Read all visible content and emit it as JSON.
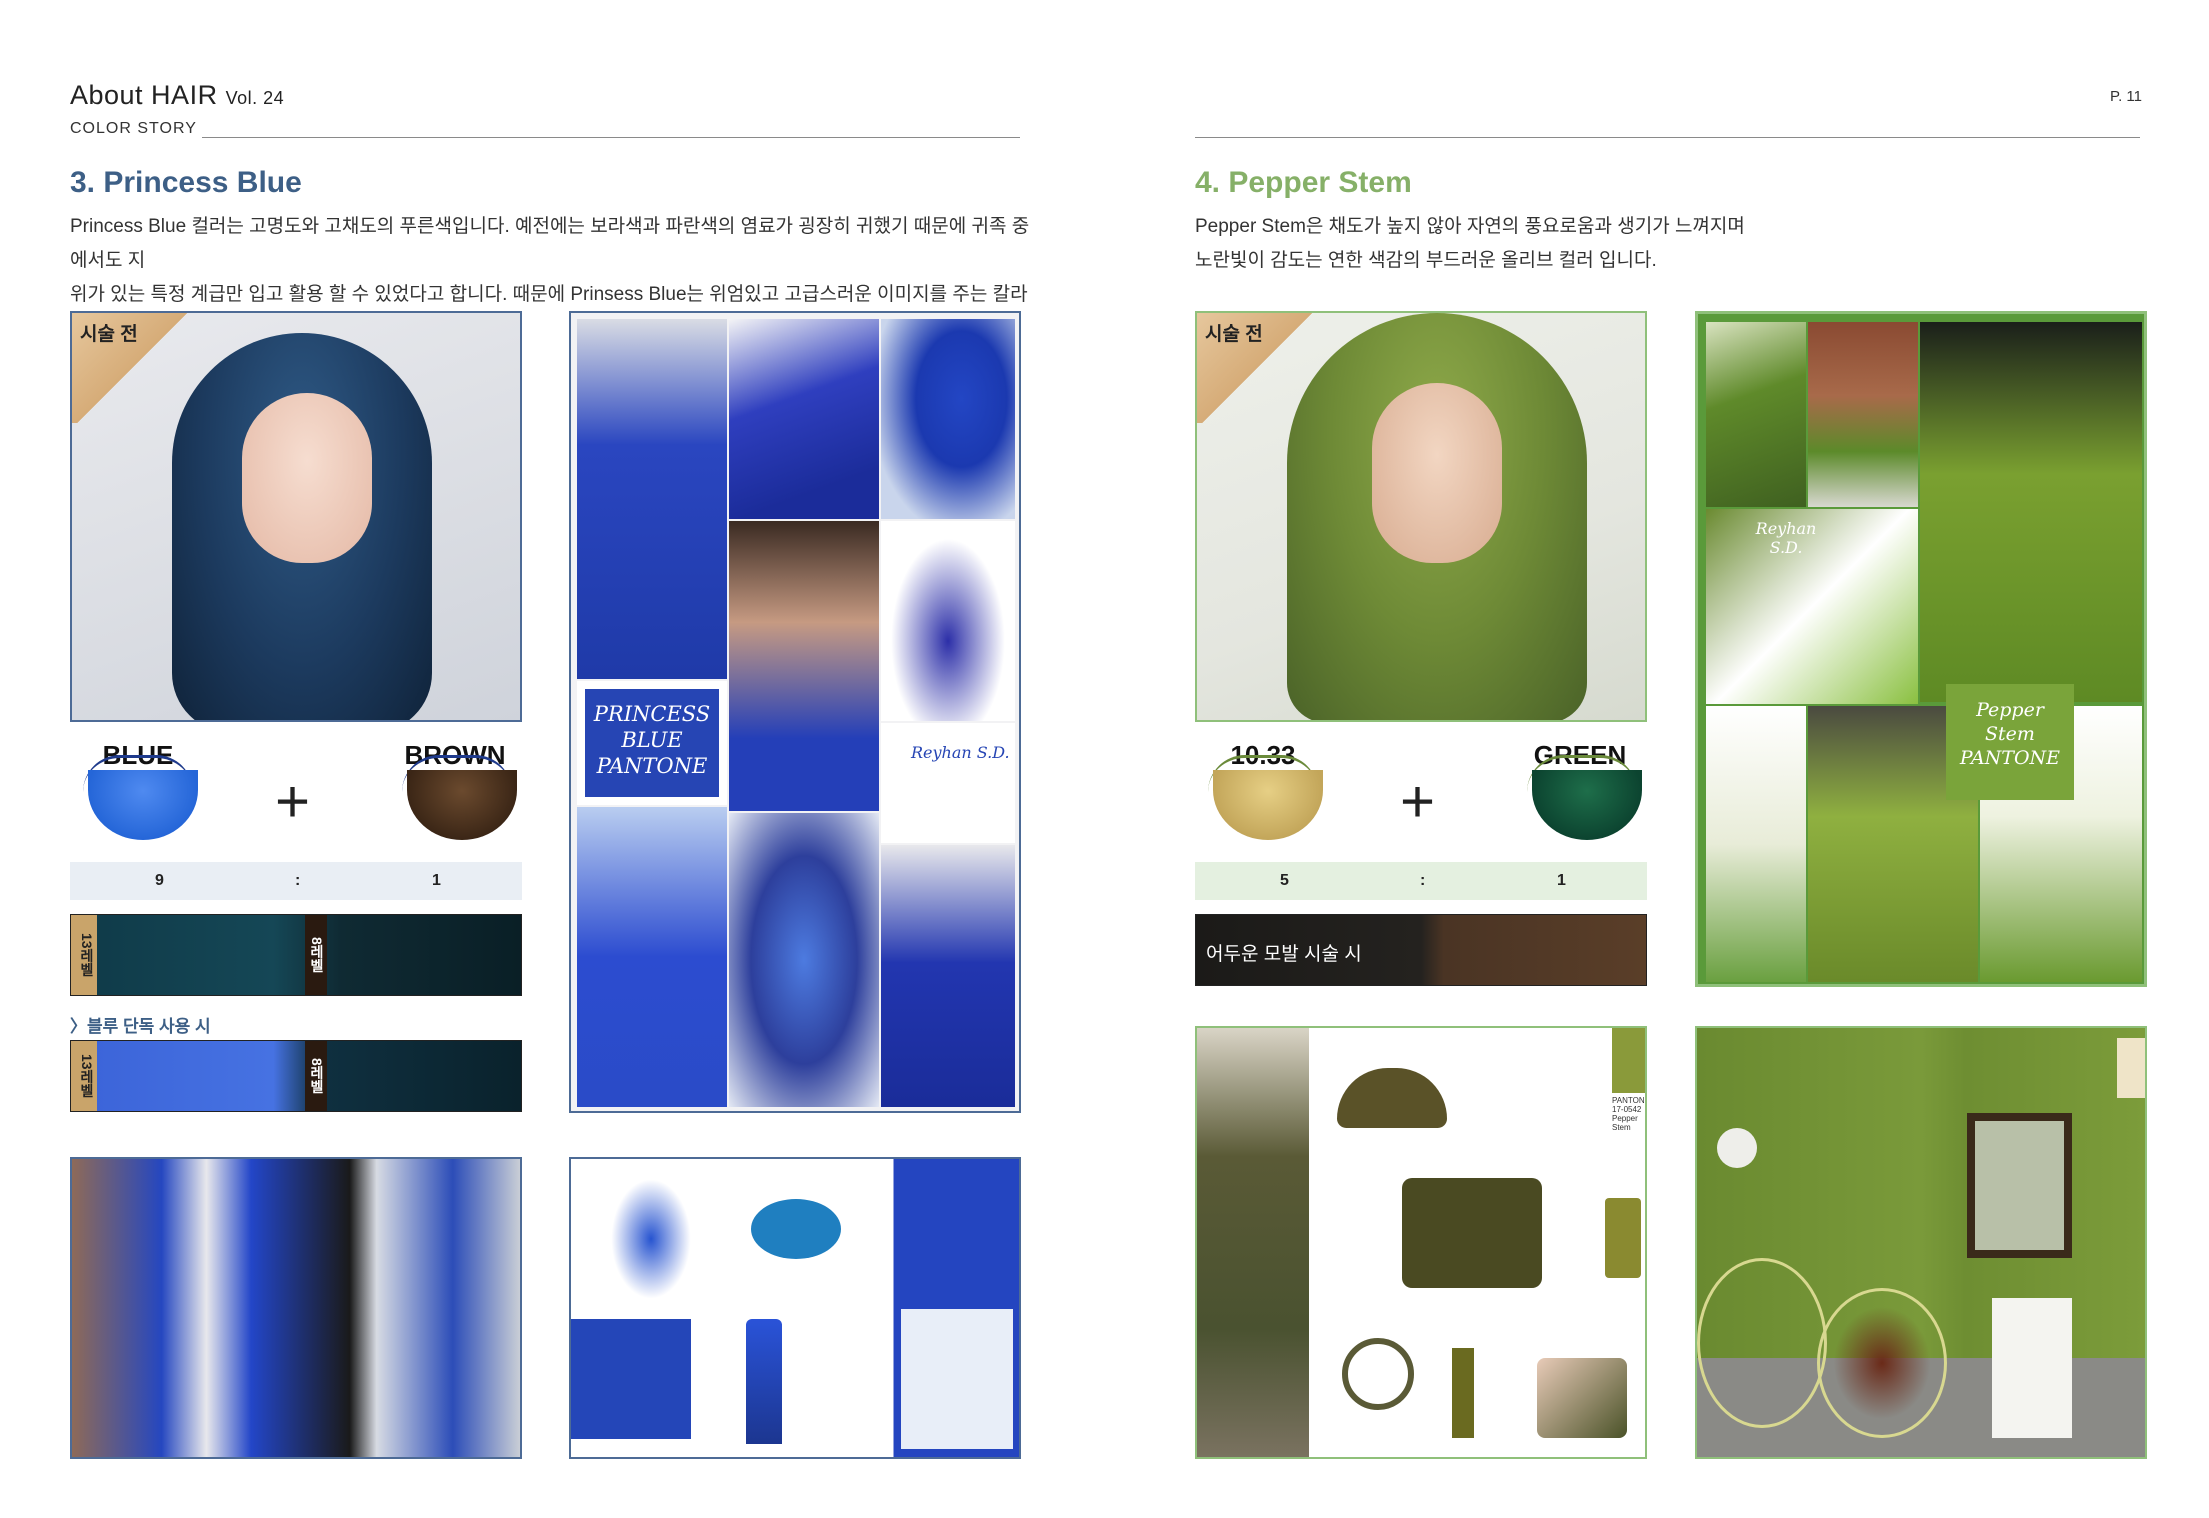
{
  "header": {
    "brand": "About HAIR",
    "volume": "Vol. 24",
    "section": "COLOR STORY",
    "page_number": "P. 11"
  },
  "left": {
    "title": "3. Princess Blue",
    "description_line1": "Princess Blue 컬러는 고명도와 고채도의 푸른색입니다. 예전에는 보라색과 파란색의 염료가 굉장히 귀했기 때문에 귀족 중에서도 지",
    "description_line2": "위가 있는 특정 계급만 입고 활용 할 수 있었다고 합니다. 때문에 Prinsess Blue는 위엄있고 고급스러운 이미지를 주는 칼라입니다.",
    "before_label": "시술 전",
    "mix": {
      "color_a": "BLUE",
      "color_b": "BROWN",
      "ratio_a": "9",
      "ratio_sep": ":",
      "ratio_b": "1"
    },
    "strand1": {
      "level_from": "13레벨",
      "level_to": "8레벨"
    },
    "single_use_label": "〉블루 단독 사용 시",
    "strand2": {
      "level_from": "13레벨",
      "level_to": "8레벨"
    },
    "pantone_card": {
      "line1": "PRINCESS",
      "line2": "BLUE",
      "line3": "PANTONE"
    },
    "watermark": "Reyhan S.D."
  },
  "right": {
    "title": "4. Pepper Stem",
    "description_line1": "Pepper Stem은 채도가 높지 않아 자연의 풍요로움과 생기가 느껴지며",
    "description_line2": "노란빛이 감도는 연한 색감의 부드러운 올리브 컬러 입니다.",
    "before_label": "시술 전",
    "mix": {
      "color_a": "10.33",
      "color_b": "GREEN",
      "ratio_a": "5",
      "ratio_sep": ":",
      "ratio_b": "1"
    },
    "strand_label": "어두운 모발 시술 시",
    "pantone_card": {
      "line1": "Pepper",
      "line2": "Stem",
      "line3": "PANTONE"
    },
    "watermark": "Reyhan S.D.",
    "chip": {
      "brand": "PANTONE",
      "code": "17-0542",
      "name": "Pepper Stem"
    }
  },
  "colors": {
    "blue_title": "#3d5f86",
    "green_title": "#86b068",
    "princess_blue": "#1f3fb8",
    "pepper_stem": "#7a9a3a"
  }
}
